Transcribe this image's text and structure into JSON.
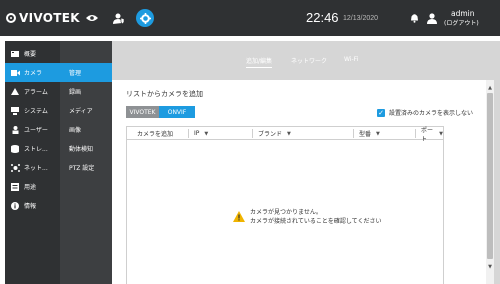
{
  "header": {
    "logo_text": "VIVOTEK",
    "time": "22:46",
    "date": "12/13/2020",
    "user": "admin",
    "logout": "(ログアウト)",
    "icons": [
      "eye-icon",
      "user-shield-icon",
      "gear-icon",
      "bell-icon",
      "person-icon"
    ],
    "accent_color": "#1d9be0"
  },
  "sidebar": {
    "items": [
      {
        "label": "概要",
        "icon": "overview-icon"
      },
      {
        "label": "カメラ",
        "icon": "camera-icon"
      },
      {
        "label": "アラーム",
        "icon": "alarm-icon"
      },
      {
        "label": "システム",
        "icon": "system-icon"
      },
      {
        "label": "ユーザー",
        "icon": "user-icon"
      },
      {
        "label": "ストレ...",
        "icon": "storage-icon"
      },
      {
        "label": "ネット...",
        "icon": "network-icon"
      },
      {
        "label": "用途",
        "icon": "usage-icon"
      },
      {
        "label": "情報",
        "icon": "info-icon"
      }
    ]
  },
  "subnav": {
    "items": [
      "管理",
      "録画",
      "メディア",
      "画像",
      "動体検知",
      "PTZ 設定"
    ]
  },
  "tabs": [
    "追加/編集",
    "ネットワーク",
    "Wi-Fi"
  ],
  "panel": {
    "title": "リストからカメラを追加",
    "source_buttons": [
      "VIVOTEK",
      "ONVIF"
    ],
    "checkbox_label": "設置済みのカメラを表示しない",
    "columns": [
      "カメラを追加",
      "IP",
      "ブランド",
      "型番",
      "ポート"
    ],
    "empty_line1": "カメラが見つかりません。",
    "empty_line2": "カメラが接続されていることを確認してください"
  }
}
